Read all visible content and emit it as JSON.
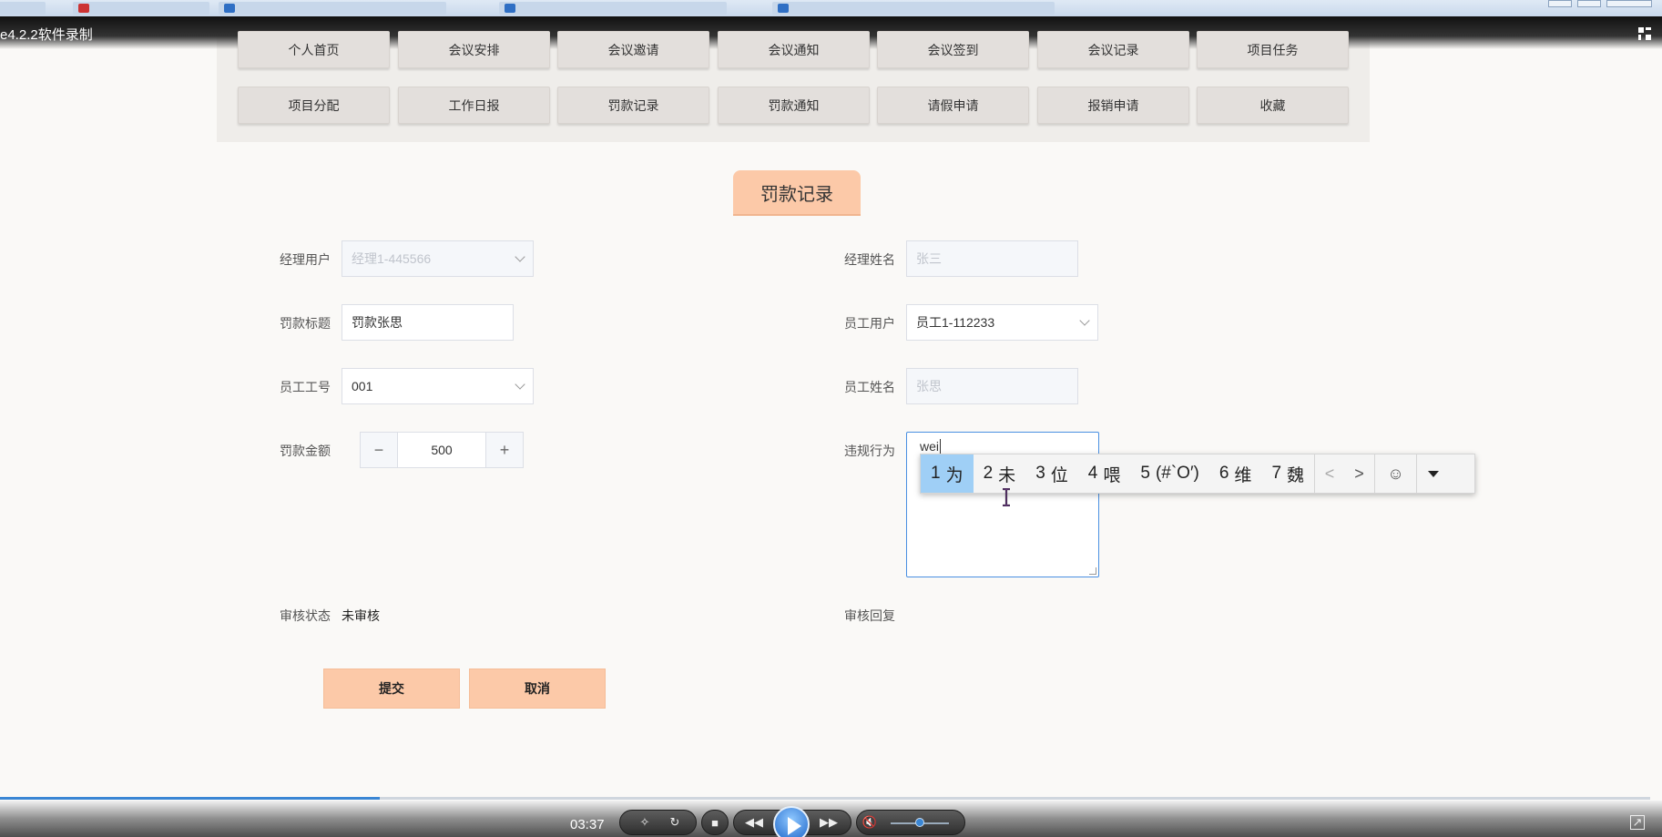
{
  "player": {
    "title": "e4.2.2软件录制",
    "time": "03:37",
    "progress_percent": 23
  },
  "nav": {
    "row1": [
      "个人首页",
      "会议安排",
      "会议邀请",
      "会议通知",
      "会议签到",
      "会议记录",
      "项目任务"
    ],
    "row2": [
      "项目分配",
      "工作日报",
      "罚款记录",
      "罚款通知",
      "请假申请",
      "报销申请",
      "收藏"
    ]
  },
  "page": {
    "title": "罚款记录"
  },
  "form": {
    "manager_user": {
      "label": "经理用户",
      "value": "经理1-445566"
    },
    "manager_name": {
      "label": "经理姓名",
      "value": "张三"
    },
    "fine_title": {
      "label": "罚款标题",
      "value": "罚款张思"
    },
    "employee_user": {
      "label": "员工用户",
      "value": "员工1-112233"
    },
    "employee_no": {
      "label": "员工工号",
      "value": "001"
    },
    "employee_name": {
      "label": "员工姓名",
      "value": "张思"
    },
    "fine_amount": {
      "label": "罚款金额",
      "value": "500",
      "minus": "−",
      "plus": "+"
    },
    "violation": {
      "label": "违规行为",
      "value": "wei"
    },
    "review_status": {
      "label": "审核状态",
      "value": "未审核"
    },
    "review_reply": {
      "label": "审核回复"
    },
    "submit_label": "提交",
    "cancel_label": "取消"
  },
  "ime": {
    "candidates": [
      {
        "num": "1",
        "text": "为"
      },
      {
        "num": "2",
        "text": "未"
      },
      {
        "num": "3",
        "text": "位"
      },
      {
        "num": "4",
        "text": "喂"
      },
      {
        "num": "5",
        "text": "(#`O′)"
      },
      {
        "num": "6",
        "text": "维"
      },
      {
        "num": "7",
        "text": "魏"
      }
    ],
    "prev": "<",
    "next": ">",
    "emoji": "☺",
    "highlight_color": "#9fcff6"
  },
  "colors": {
    "accent": "#fcc9a8",
    "focus": "#4a90e2",
    "progress": "#3a86d4"
  }
}
